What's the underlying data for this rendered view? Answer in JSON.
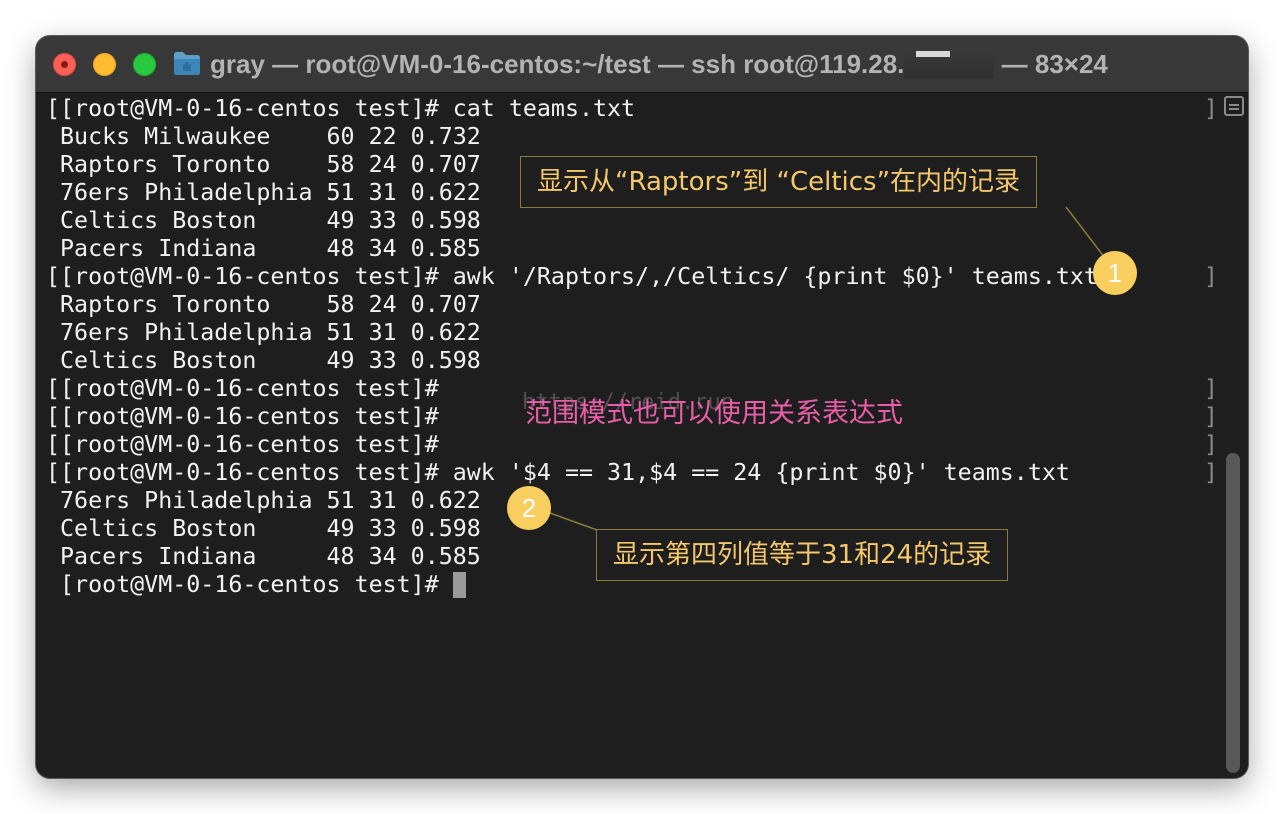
{
  "window": {
    "title_prefix": "gray — root@VM-0-16-centos:~/test — ssh root@119.28.",
    "title_suffix": "— 83×24",
    "icon": "folder-icon"
  },
  "terminal": {
    "lines": [
      "[[root@VM-0-16-centos test]# cat teams.txt",
      " Bucks Milwaukee    60 22 0.732",
      " Raptors Toronto    58 24 0.707",
      " 76ers Philadelphia 51 31 0.622",
      " Celtics Boston     49 33 0.598",
      " Pacers Indiana     48 34 0.585",
      "[[root@VM-0-16-centos test]# awk '/Raptors/,/Celtics/ {print $0}' teams.txt",
      " Raptors Toronto    58 24 0.707",
      " 76ers Philadelphia 51 31 0.622",
      " Celtics Boston     49 33 0.598",
      "[[root@VM-0-16-centos test]#",
      "[[root@VM-0-16-centos test]#",
      "[[root@VM-0-16-centos test]#",
      "[[root@VM-0-16-centos test]# awk '$4 == 31,$4 == 24 {print $0}' teams.txt",
      " 76ers Philadelphia 51 31 0.622",
      " Celtics Boston     49 33 0.598",
      " Pacers Indiana     48 34 0.585",
      " [root@VM-0-16-centos test]# "
    ],
    "right_marker": "]"
  },
  "annotations": {
    "callout1_text": "显示从“Raptors”到 “Celtics”在内的记录",
    "callout2_text": "显示第四列值等于31和24的记录",
    "badge1": "1",
    "badge2": "2",
    "pink_note": "范围模式也可以使用关系表达式",
    "watermark": "https://reid.run"
  },
  "colors": {
    "terminal_bg": "#1e1e1e",
    "terminal_text": "#f2f2f2",
    "callout_text": "#f5c76b",
    "badge_bg": "#f8cf5e",
    "pink_note": "#e85ea9"
  }
}
